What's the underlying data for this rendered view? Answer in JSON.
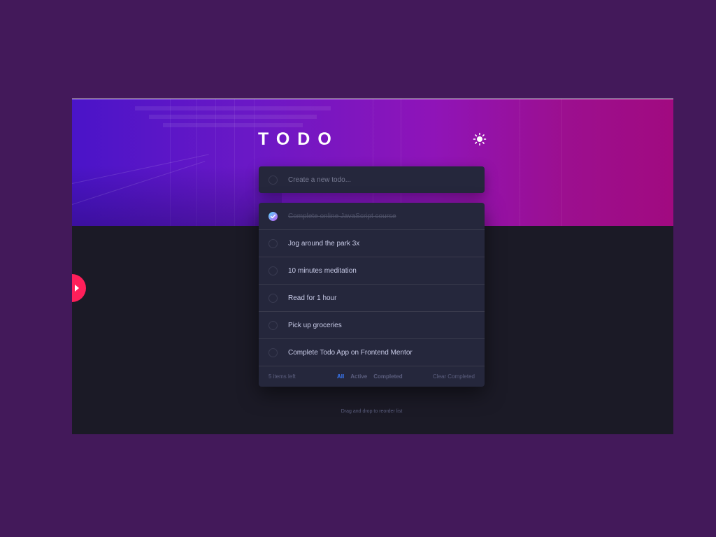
{
  "app": {
    "title": "TODO",
    "theme_toggle_icon": "sun-icon",
    "colors": {
      "background": "#43195a",
      "dark_bg": "#1b1a26",
      "card": "#25273c",
      "accent": "#3a7bfd",
      "check_gradient_start": "#57ddff",
      "check_gradient_end": "#c058f3",
      "side_tab": "#ff1f5a"
    }
  },
  "new_todo": {
    "placeholder": "Create a new todo..."
  },
  "todos": [
    {
      "text": "Complete online JavaScript course",
      "completed": true
    },
    {
      "text": "Jog around the park 3x",
      "completed": false
    },
    {
      "text": "10 minutes meditation",
      "completed": false
    },
    {
      "text": "Read for 1 hour",
      "completed": false
    },
    {
      "text": "Pick up groceries",
      "completed": false
    },
    {
      "text": "Complete Todo App on Frontend Mentor",
      "completed": false
    }
  ],
  "footer": {
    "items_left": "5 items left",
    "filters": {
      "all": "All",
      "active": "Active",
      "completed": "Completed"
    },
    "active_filter": "All",
    "clear": "Clear Completed"
  },
  "hint": "Drag and drop to reorder list",
  "side_tab": {
    "icon": "chevron-right-icon"
  }
}
